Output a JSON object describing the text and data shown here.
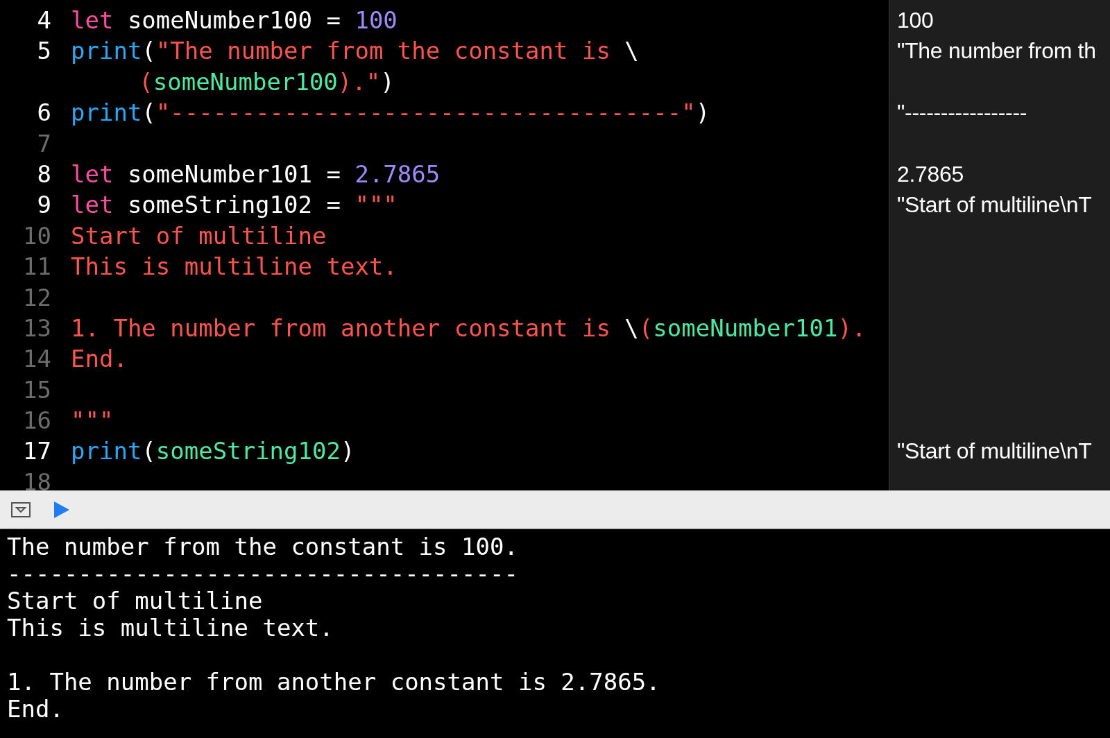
{
  "editor": {
    "lines": [
      {
        "number": "4",
        "active": true,
        "result": "100",
        "tokens": [
          {
            "kind": "keyword",
            "text": "let"
          },
          {
            "kind": "plain",
            "text": " someNumber100 = "
          },
          {
            "kind": "number",
            "text": "100"
          }
        ]
      },
      {
        "number": "5",
        "active": true,
        "result": "\"The number from th",
        "tokens": [
          {
            "kind": "call",
            "text": "print"
          },
          {
            "kind": "plain",
            "text": "("
          },
          {
            "kind": "string",
            "text": "\"The number from the constant is "
          },
          {
            "kind": "plain",
            "text": "\\"
          }
        ],
        "continuation": [
          {
            "kind": "string",
            "text": "("
          },
          {
            "kind": "ident",
            "text": "someNumber100"
          },
          {
            "kind": "string",
            "text": ").\""
          },
          {
            "kind": "plain",
            "text": ")"
          }
        ]
      },
      {
        "number": "6",
        "active": true,
        "result": "\"-----------------",
        "tokens": [
          {
            "kind": "call",
            "text": "print"
          },
          {
            "kind": "plain",
            "text": "("
          },
          {
            "kind": "string",
            "text": "\"------------------------------------\""
          },
          {
            "kind": "plain",
            "text": ")"
          }
        ]
      },
      {
        "number": "7",
        "active": false
      },
      {
        "number": "8",
        "active": true,
        "result": "2.7865",
        "tokens": [
          {
            "kind": "keyword",
            "text": "let"
          },
          {
            "kind": "plain",
            "text": " someNumber101 = "
          },
          {
            "kind": "number",
            "text": "2.7865"
          }
        ]
      },
      {
        "number": "9",
        "active": true,
        "result": "\"Start of multiline\\nT",
        "tokens": [
          {
            "kind": "keyword",
            "text": "let"
          },
          {
            "kind": "plain",
            "text": " someString102 = "
          },
          {
            "kind": "string",
            "text": "\"\"\""
          }
        ]
      },
      {
        "number": "10",
        "active": false,
        "tokens": [
          {
            "kind": "string",
            "text": "Start of multiline"
          }
        ]
      },
      {
        "number": "11",
        "active": false,
        "tokens": [
          {
            "kind": "string",
            "text": "This is multiline text."
          }
        ]
      },
      {
        "number": "12",
        "active": false
      },
      {
        "number": "13",
        "active": false,
        "tokens": [
          {
            "kind": "string",
            "text": "1. The number from another constant is "
          },
          {
            "kind": "plain",
            "text": "\\"
          },
          {
            "kind": "string",
            "text": "("
          },
          {
            "kind": "ident",
            "text": "someNumber101"
          },
          {
            "kind": "string",
            "text": ")."
          }
        ]
      },
      {
        "number": "14",
        "active": false,
        "tokens": [
          {
            "kind": "string",
            "text": "End."
          }
        ]
      },
      {
        "number": "15",
        "active": false
      },
      {
        "number": "16",
        "active": false,
        "tokens": [
          {
            "kind": "string",
            "text": "\"\"\""
          }
        ]
      },
      {
        "number": "17",
        "active": true,
        "result": "\"Start of multiline\\nT",
        "tokens": [
          {
            "kind": "call",
            "text": "print"
          },
          {
            "kind": "plain",
            "text": "("
          },
          {
            "kind": "ident",
            "text": "someString102"
          },
          {
            "kind": "plain",
            "text": ")"
          }
        ]
      },
      {
        "number": "18",
        "active": false
      }
    ]
  },
  "console": {
    "blocks": [
      [
        "The number from the constant is 100.",
        "------------------------------------",
        "Start of multiline",
        "This is multiline text."
      ],
      [
        "1. The number from another constant is 2.7865.",
        "End."
      ]
    ]
  }
}
